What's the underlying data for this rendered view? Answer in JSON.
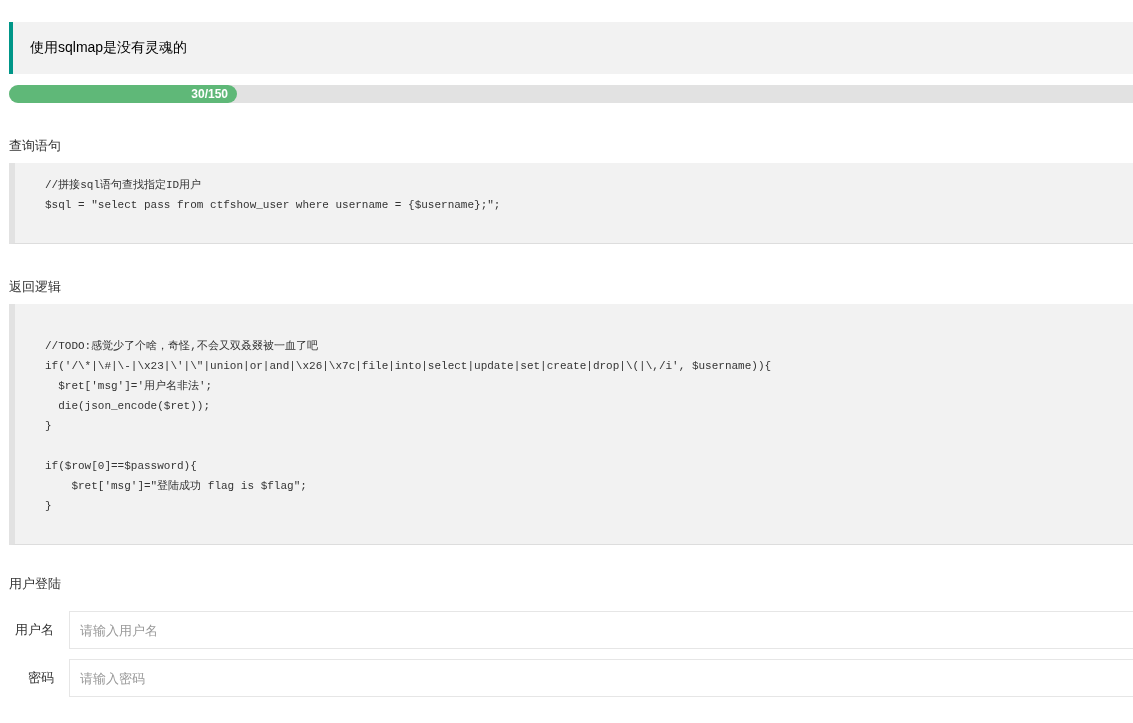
{
  "notice": {
    "text": "使用sqlmap是没有灵魂的"
  },
  "progress": {
    "label": "30/150",
    "level": 0.2
  },
  "sections": [
    {
      "heading": "查询语句",
      "code": "//拼接sql语句查找指定ID用户\n$sql = \"select pass from ctfshow_user where username = {$username};\";"
    },
    {
      "heading": "返回逻辑",
      "code": "\n//TODO:感觉少了个啥，奇怪,不会又双叒叕被一血了吧\nif('/\\*|\\#|\\-|\\x23|\\'|\\\"|union|or|and|\\x26|\\x7c|file|into|select|update|set|create|drop|\\(|\\,/i', $username)){\n  $ret['msg']='用户名非法';\n  die(json_encode($ret));\n}\n\nif($row[0]==$password){\n    $ret['msg']=\"登陆成功 flag is $flag\";\n}"
    }
  ],
  "login": {
    "heading": "用户登陆",
    "fields": [
      {
        "label": "用户名",
        "placeholder": "请输入用户名"
      },
      {
        "label": "密码",
        "placeholder": "请输入密码"
      }
    ]
  }
}
